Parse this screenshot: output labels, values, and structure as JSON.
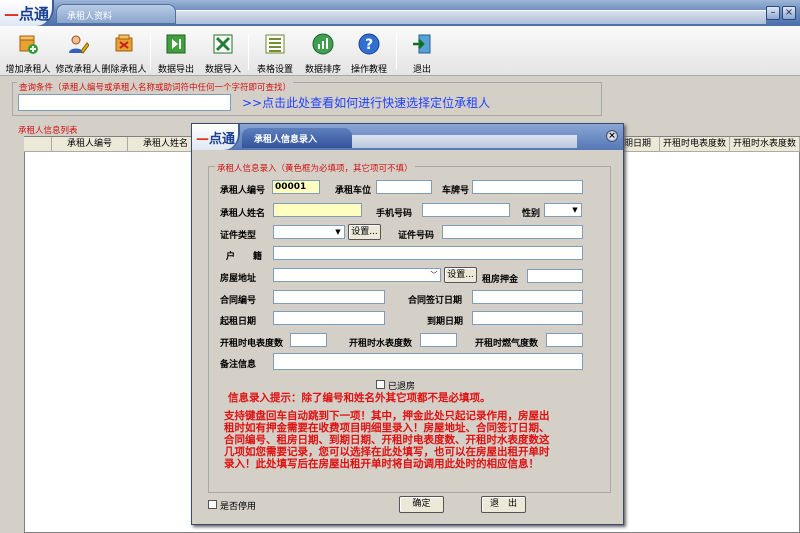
{
  "app": {
    "logo": "点通",
    "tab": "承租人资料"
  },
  "toolbar": [
    {
      "name": "add-tenant-button",
      "label": "增加承租人",
      "icon": "add-user-icon"
    },
    {
      "name": "edit-tenant-button",
      "label": "修改承租人",
      "icon": "edit-user-icon"
    },
    {
      "name": "delete-tenant-button",
      "label": "删除承租人",
      "icon": "delete-user-icon"
    },
    {
      "name": "export-data-button",
      "label": "数据导出",
      "icon": "export-icon"
    },
    {
      "name": "import-data-button",
      "label": "数据导入",
      "icon": "excel-icon"
    },
    {
      "name": "table-settings-button",
      "label": "表格设置",
      "icon": "list-icon"
    },
    {
      "name": "sort-data-button",
      "label": "数据排序",
      "icon": "chart-icon"
    },
    {
      "name": "tutorial-button",
      "label": "操作教程",
      "icon": "help-icon"
    },
    {
      "name": "exit-button",
      "label": "退出",
      "icon": "exit-icon"
    }
  ],
  "query": {
    "title": "查询条件（承租人编号或承租人名称或助词符中任何一个字符即可查找）",
    "value": "",
    "link": ">>点击此处查看如何进行快速选择定位承租人"
  },
  "list": {
    "title": "承租人信息列表",
    "columns": [
      "承租人编号",
      "承租人姓名",
      "期日期",
      "开租时电表度数",
      "开租时水表度数"
    ]
  },
  "dialog": {
    "logo": "点通",
    "title": "承租人信息录入",
    "group_title": "承租人信息录入（黄色框为必填项，其它项可不填）",
    "fields": {
      "tenant_no_label": "承租人编号",
      "tenant_no_value": "00001",
      "parking_label": "承租车位",
      "plate_label": "车牌号",
      "name_label": "承租人姓名",
      "phone_label": "手机号码",
      "gender_label": "性别",
      "id_type_label": "证件类型",
      "settings_label": "设置...",
      "id_no_label": "证件号码",
      "huji_label": "户　　籍",
      "address_label": "房屋地址",
      "settings2_label": "设置...",
      "deposit_label": "租房押金",
      "contract_no_label": "合同编号",
      "contract_date_label": "合同签订日期",
      "start_date_label": "起租日期",
      "end_date_label": "到期日期",
      "electric_label": "开租时电表度数",
      "water_label": "开租时水表度数",
      "gas_label": "开租时燃气度数",
      "remark_label": "备注信息",
      "moved_out_label": "已退房"
    },
    "hint1": "信息录入提示：除了编号和姓名外其它项都不是必填项。",
    "hint2": [
      "支持键盘回车自动跳到下一项！其中，押金此处只起记录作用，房屋出",
      "租时如有押金需要在收费项目明细里录入！房屋地址、合同签订日期、",
      "合同编号、租房日期、到期日期、开租时电表度数、开租时水表度数这",
      "几项如您需要记录，您可以选择在此处填写，也可以在房屋出租开单时",
      "录入！此处填写后在房屋出租开单时将自动调用此处时的相应信息！"
    ],
    "disabled_label": "是否停用",
    "ok_label": "确定",
    "exit_label": "退　出"
  }
}
